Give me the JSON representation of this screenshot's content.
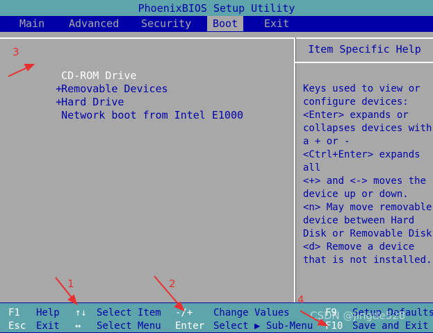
{
  "title": "PhoenixBIOS Setup Utility",
  "menu": [
    {
      "label": "Main",
      "active": false
    },
    {
      "label": "Advanced",
      "active": false
    },
    {
      "label": "Security",
      "active": false
    },
    {
      "label": "Boot",
      "active": true
    },
    {
      "label": "Exit",
      "active": false
    }
  ],
  "boot_items": [
    {
      "prefix": "",
      "label": "CD-ROM Drive",
      "selected": true
    },
    {
      "prefix": "+",
      "label": "Removable Devices",
      "selected": false
    },
    {
      "prefix": "+",
      "label": "Hard Drive",
      "selected": false
    },
    {
      "prefix": "",
      "label": "Network boot from Intel E1000",
      "selected": false
    }
  ],
  "help": {
    "title": "Item Specific Help",
    "lines": [
      "Keys used to view or",
      "configure devices:",
      "<Enter> expands or",
      "collapses devices with",
      "a + or -",
      "<Ctrl+Enter> expands",
      "all",
      "<+> and <-> moves the",
      "device up or down.",
      "<n> May move removable",
      "device between Hard",
      "Disk or Removable Disk",
      "<d> Remove a device",
      "that is not installed."
    ]
  },
  "footer": {
    "row1": [
      {
        "key": "F1",
        "desc": "Help"
      },
      {
        "key": "↑↓",
        "desc": "Select Item"
      },
      {
        "key": "-/+",
        "desc": "Change Values"
      },
      {
        "key": "F9",
        "desc": "Setup Defaults"
      }
    ],
    "row2": [
      {
        "key": "Esc",
        "desc": "Exit"
      },
      {
        "key": "↔",
        "desc": "Select Menu"
      },
      {
        "key": "Enter",
        "desc": "Select ▶ Sub-Menu"
      },
      {
        "key": "F10",
        "desc": "Save and Exit"
      }
    ]
  },
  "annotations": [
    "1",
    "2",
    "3",
    "4"
  ],
  "watermark": "CSDN @jingde528",
  "colors": {
    "bios_blue": "#0000a8",
    "bios_gray": "#a8a8a8",
    "bios_teal": "#5ea5ab",
    "annotation_red": "#e83030"
  }
}
